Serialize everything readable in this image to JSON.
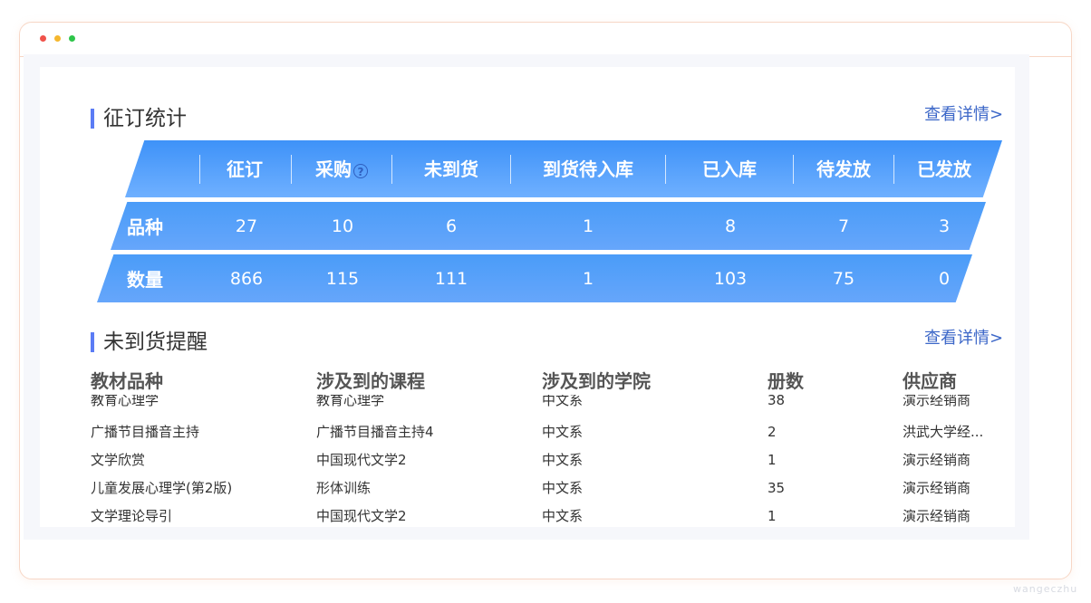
{
  "section1": {
    "title": "征订统计",
    "detail_link": "查看详情>",
    "headers": [
      "征订",
      "采购",
      "未到货",
      "到货待入库",
      "已入库",
      "待发放",
      "已发放"
    ],
    "help_icon": "?",
    "rows": [
      {
        "label": "品种",
        "values": [
          "27",
          "10",
          "6",
          "1",
          "8",
          "7",
          "3"
        ]
      },
      {
        "label": "数量",
        "values": [
          "866",
          "115",
          "111",
          "1",
          "103",
          "75",
          "0"
        ]
      }
    ]
  },
  "section2": {
    "title": "未到货提醒",
    "detail_link": "查看详情>",
    "columns": [
      "教材品种",
      "涉及到的课程",
      "涉及到的学院",
      "册数",
      "供应商"
    ],
    "rows": [
      [
        "教育心理学",
        "教育心理学",
        "中文系",
        "38",
        "演示经销商"
      ],
      [
        "广播节目播音主持",
        "广播节目播音主持4",
        "中文系",
        "2",
        "洪武大学经..."
      ],
      [
        "文学欣赏",
        "中国现代文学2",
        "中文系",
        "1",
        "演示经销商"
      ],
      [
        "儿童发展心理学(第2版)",
        "形体训练",
        "中文系",
        "35",
        "演示经销商"
      ],
      [
        "文学理论导引",
        "中国现代文学2",
        "中文系",
        "1",
        "演示经销商"
      ]
    ]
  },
  "watermark": "wangeczhu"
}
